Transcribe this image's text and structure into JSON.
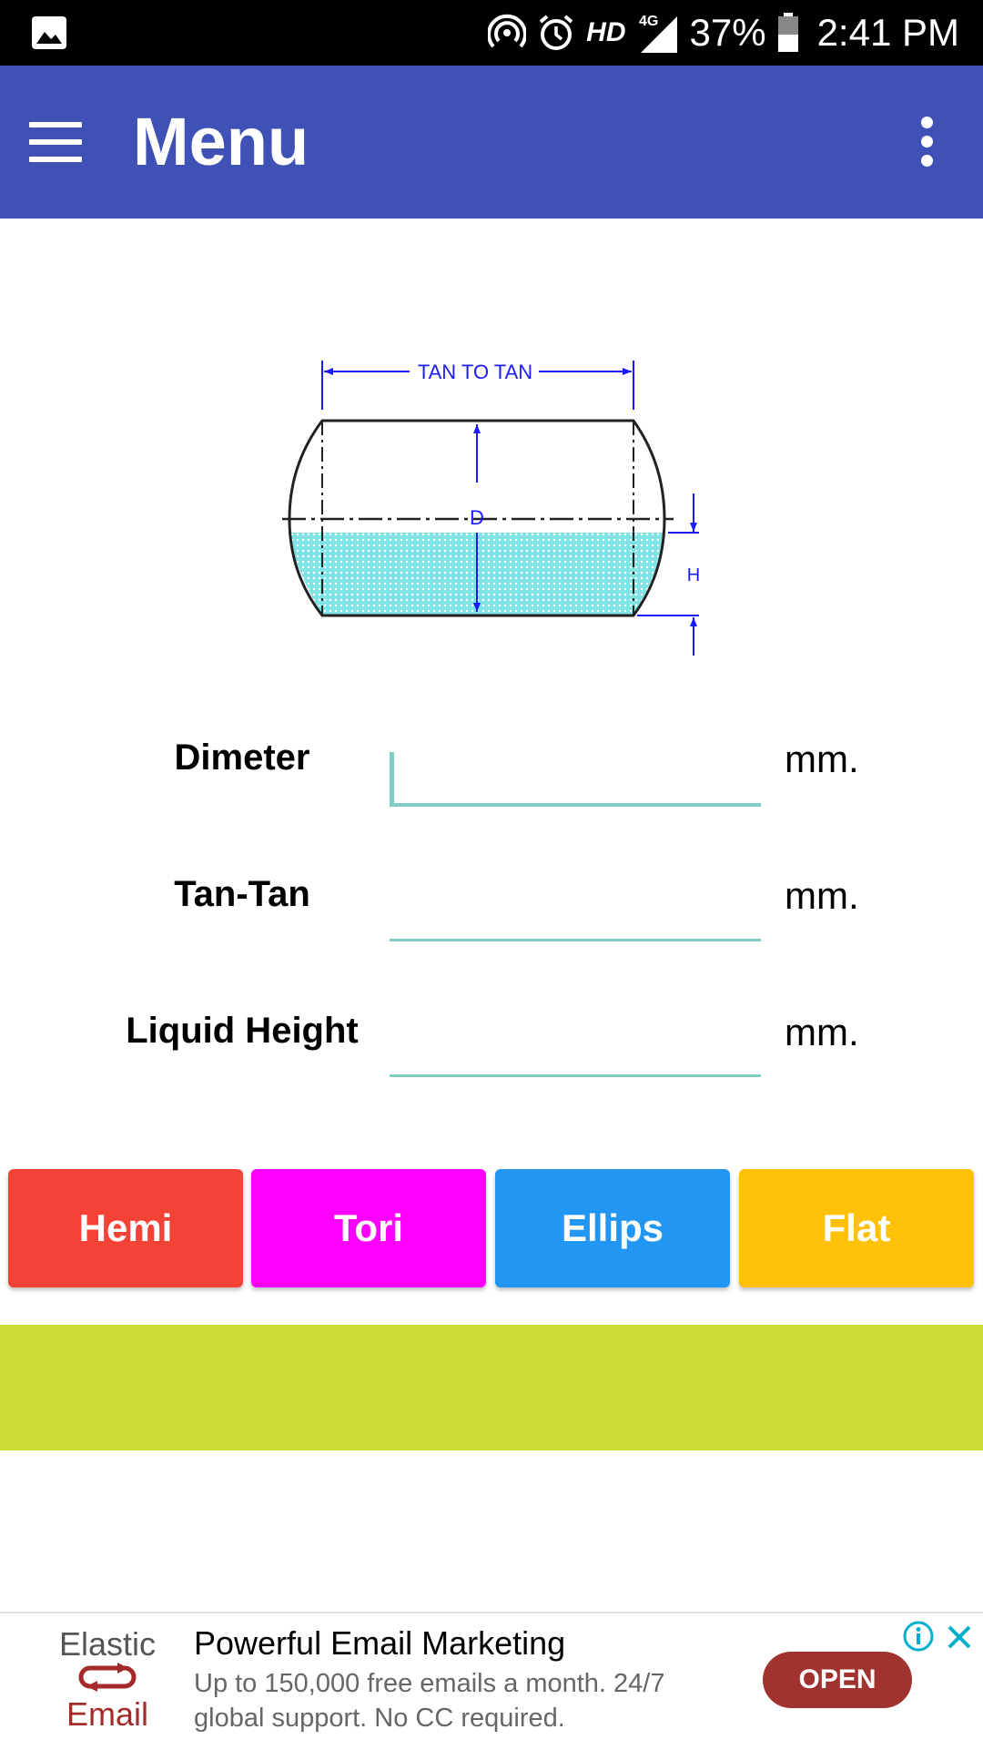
{
  "status_bar": {
    "battery": "37%",
    "network": "HD",
    "signal": "4G",
    "time": "2:41 PM",
    "icons": [
      "gallery-icon",
      "hotspot-icon",
      "alarm-icon",
      "signal-icon",
      "battery-icon"
    ]
  },
  "app_bar": {
    "title": "Menu",
    "background": "#3f51b5"
  },
  "diagram": {
    "dim_tan": "TAN TO TAN",
    "dim_d": "D",
    "dim_h": "H",
    "liquid_color": "#7fe3e6"
  },
  "form": {
    "rows": [
      {
        "label": "Dimeter",
        "value": "",
        "unit": "mm."
      },
      {
        "label": "Tan-Tan",
        "value": "",
        "unit": "mm."
      },
      {
        "label": "Liquid Height",
        "value": "",
        "unit": "mm."
      }
    ],
    "accent": "#80cbc4"
  },
  "buttons": [
    {
      "label": "Hemi",
      "color": "#f44336"
    },
    {
      "label": "Tori",
      "color": "#ff00ff"
    },
    {
      "label": "Ellips",
      "color": "#2196f3"
    },
    {
      "label": "Flat",
      "color": "#ffc107"
    }
  ],
  "result_bar": {
    "color": "#cddc39"
  },
  "ad": {
    "logo_line1": "Elastic",
    "logo_line2": "Email",
    "headline": "Powerful Email Marketing",
    "body": "Up to 150,000 free emails a month. 24/7 global support. No CC required.",
    "cta": "OPEN"
  }
}
